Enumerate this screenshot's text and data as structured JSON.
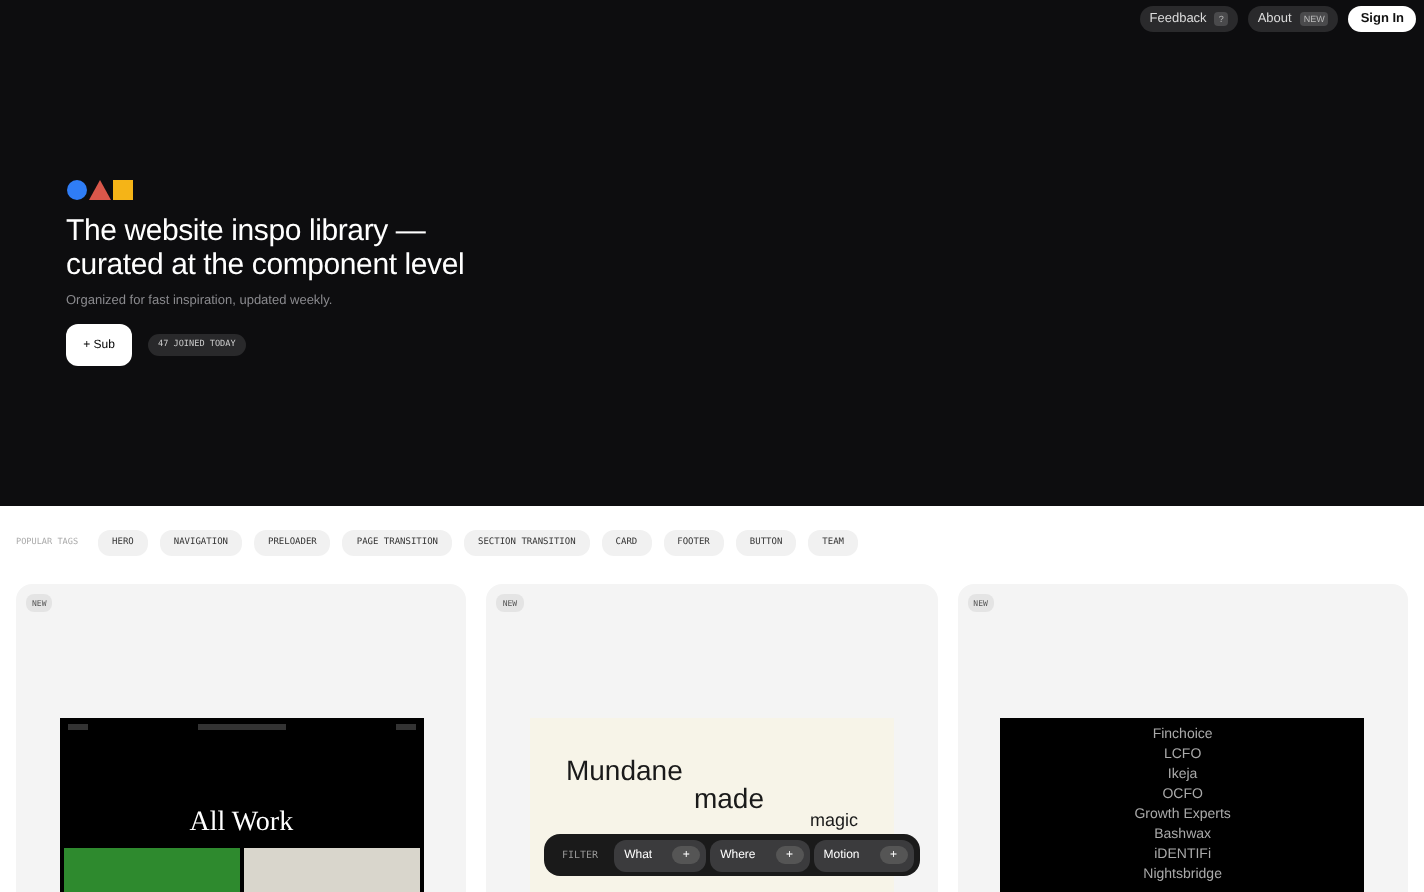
{
  "header": {
    "buttons": [
      {
        "label": "Feedback",
        "badge": "?",
        "kind": "ghost"
      },
      {
        "label": "About",
        "badge": "NEW",
        "kind": "ghost"
      },
      {
        "label": "Sign In",
        "kind": "primary"
      }
    ]
  },
  "hero": {
    "title": "The website inspo library —",
    "title_line2": "curated at the component level",
    "subtitle": "Organized for fast inspiration, updated weekly.",
    "subscribe_button": "+ Sub",
    "joined_badge": "47 JOINED TODAY"
  },
  "tags": {
    "label": "POPULAR TAGS",
    "items": [
      "HERO",
      "NAVIGATION",
      "PRELOADER",
      "PAGE TRANSITION",
      "SECTION TRANSITION",
      "CARD",
      "FOOTER",
      "BUTTON",
      "TEAM"
    ]
  },
  "cards": [
    {
      "badge": "NEW",
      "kind": "work",
      "heading": "All Work"
    },
    {
      "badge": "NEW",
      "kind": "mundane",
      "words": [
        "Mundane",
        "made",
        "magic"
      ]
    },
    {
      "badge": "NEW",
      "kind": "list",
      "items": [
        "Finchoice",
        "LCFO",
        "Ikeja",
        "OCFO",
        "Growth Experts",
        "Bashwax",
        "iDENTIFi",
        "Nightsbridge"
      ]
    }
  ],
  "filter_bar": {
    "label": "FILTER",
    "items": [
      {
        "label": "What",
        "icon": "+"
      },
      {
        "label": "Where",
        "icon": "+"
      },
      {
        "label": "Motion",
        "icon": "+"
      }
    ]
  }
}
